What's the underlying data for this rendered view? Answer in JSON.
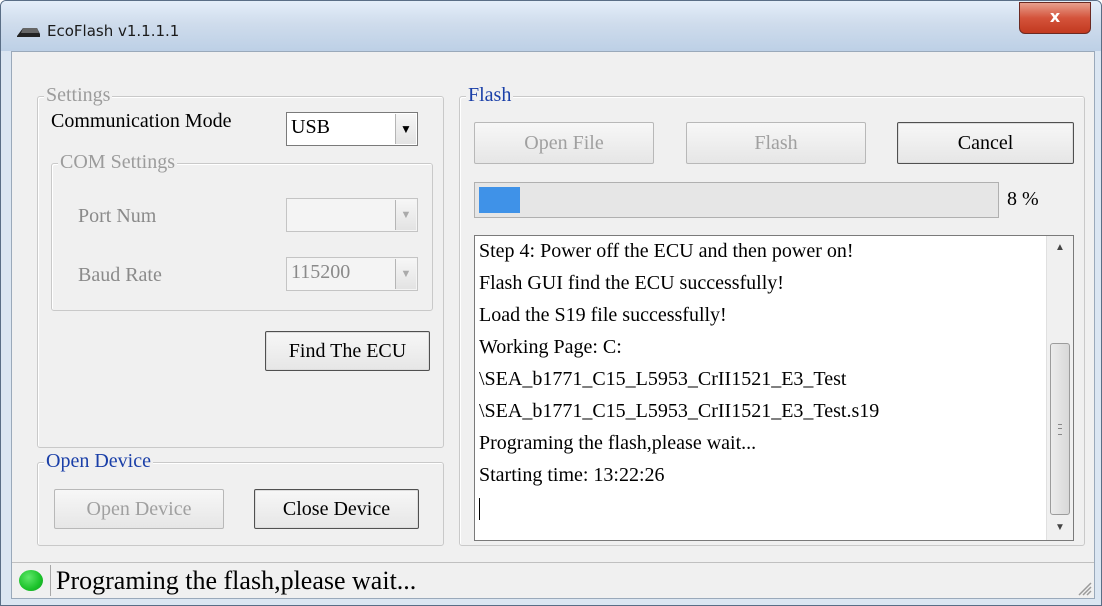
{
  "window": {
    "title": "EcoFlash v1.1.1.1",
    "close_label": "x"
  },
  "settings": {
    "legend": "Settings",
    "comm_mode_label": "Communication Mode",
    "comm_mode_value": "USB",
    "com_settings": {
      "legend": "COM Settings",
      "port_label": "Port Num",
      "port_value": "",
      "baud_label": "Baud Rate",
      "baud_value": "115200"
    },
    "find_button": "Find The ECU"
  },
  "open_device": {
    "legend": "Open Device",
    "open_button": "Open Device",
    "close_button": "Close Device"
  },
  "flash": {
    "legend": "Flash",
    "open_file_button": "Open File",
    "flash_button": "Flash",
    "cancel_button": "Cancel",
    "progress_fraction": 0.08,
    "progress_text": "8 %",
    "log": [
      "Step 4: Power off the ECU and then power on!",
      "Flash GUI find the ECU successfully!",
      "Load the S19 file successfully!",
      "Working Page: C:",
      "\\SEA_b1771_C15_L5953_CrII1521_E3_Test",
      "\\SEA_b1771_C15_L5953_CrII1521_E3_Test.s19",
      "Programing the flash,please wait...",
      "Starting time: 13:22:26"
    ]
  },
  "status": {
    "text": "Programing the flash,please wait...",
    "led_color": "#1bc22a"
  },
  "icons": {
    "app": "chip-icon",
    "resize": "resize-grip-icon"
  }
}
